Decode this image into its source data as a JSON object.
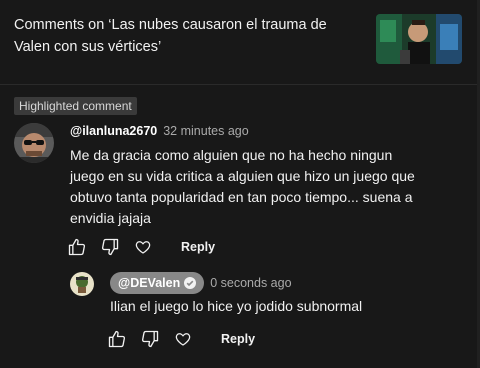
{
  "header": {
    "title": "Comments on ‘Las nubes causaron el trauma de Valen con sus vértices’",
    "thumbnail_icon": "video-thumbnail"
  },
  "highlighted_label": "Highlighted comment",
  "comment": {
    "author": "@ilanluna2670",
    "time": "32 minutes ago",
    "text": "Me da gracia como alguien que no ha hecho ningun juego en su vida critica a alguien que hizo un juego que obtuvo tanta popularidad en tan poco tiempo... suena a envidia jajaja",
    "reply_label": "Reply"
  },
  "reply": {
    "author": "@DEValen",
    "time": "0 seconds ago",
    "text": "Ilian el juego lo hice yo jodido subnormal",
    "reply_label": "Reply",
    "verified_icon": "check-circle-icon"
  },
  "colors": {
    "background": "#181818",
    "badge": "#3a3a3a",
    "owner_chip": "#888888",
    "muted_text": "#aaaaaa"
  }
}
